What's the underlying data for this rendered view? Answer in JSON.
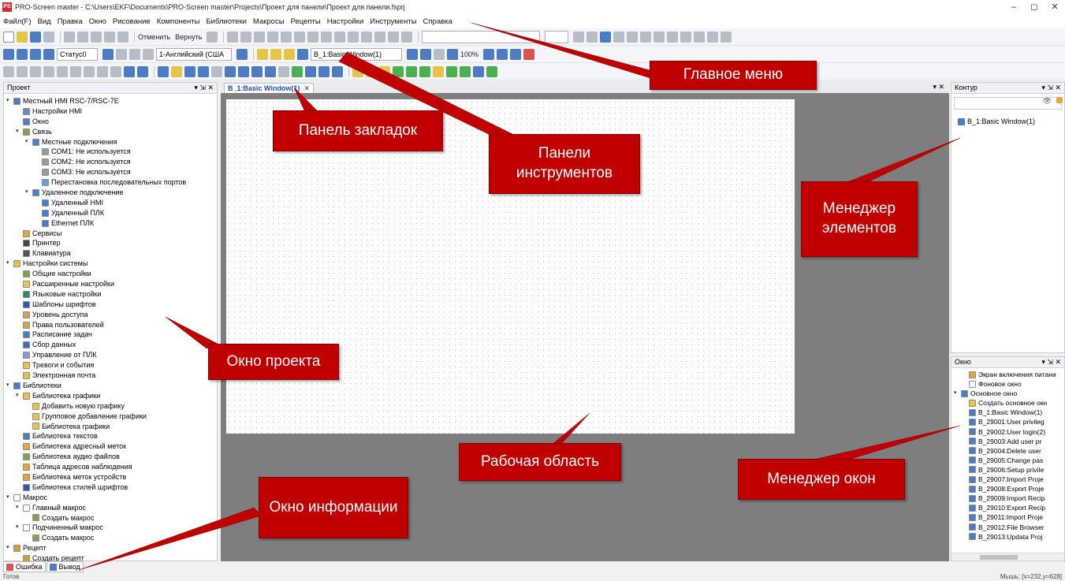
{
  "window": {
    "title": "PRO-Screen master - C:\\Users\\EKF\\Documents\\PRO-Screen master\\Projects\\Проект для панели\\Проект для панели.fsprj",
    "app_icon_text": "PS",
    "controls": [
      "–",
      "◻",
      "✕"
    ]
  },
  "menu": [
    "Файл(F)",
    "Вид",
    "Правка",
    "Окно",
    "Рисование",
    "Компоненты",
    "Библиотеки",
    "Макросы",
    "Рецепты",
    "Настройки",
    "Инструменты",
    "Справка"
  ],
  "toolbar": {
    "undo_label": "Отменить",
    "redo_label": "Вернуть",
    "status_combo": "Статус0",
    "language_combo": "1-Английский (США",
    "window_combo": "B_1:Basic Window(1)",
    "zoom": "100%"
  },
  "project_panel": {
    "title": "Проект",
    "controls": "▾ ⇲ ✕",
    "items": [
      {
        "label": "Местный HMI RSC-7/RSC-7E",
        "level": 0,
        "exp": "▾",
        "color": "#4b7cc4"
      },
      {
        "label": "Настройки HMI",
        "level": 1,
        "exp": "",
        "color": "#6b8cc8"
      },
      {
        "label": "Окно",
        "level": 1,
        "exp": "",
        "color": "#4b7cc4"
      },
      {
        "label": "Связь",
        "level": 1,
        "exp": "▾",
        "color": "#7fa44f"
      },
      {
        "label": "Местные подключения",
        "level": 2,
        "exp": "▾",
        "color": "#4b7cc4"
      },
      {
        "label": "COM1: Не используется",
        "level": 3,
        "exp": "",
        "color": "#9a9a9a"
      },
      {
        "label": "COM2: Не используется",
        "level": 3,
        "exp": "",
        "color": "#9a9a9a"
      },
      {
        "label": "COM3: Не используется",
        "level": 3,
        "exp": "",
        "color": "#9a9a9a"
      },
      {
        "label": "Перестановка последовательных портов",
        "level": 3,
        "exp": "",
        "color": "#6aa0d8"
      },
      {
        "label": "Удаленное подключение",
        "level": 2,
        "exp": "▾",
        "color": "#4b7cc4"
      },
      {
        "label": "Удаленный HMI",
        "level": 3,
        "exp": "",
        "color": "#4b7cc4"
      },
      {
        "label": "Удаленный ПЛК",
        "level": 3,
        "exp": "",
        "color": "#4b7cc4"
      },
      {
        "label": "Ethernet ПЛК",
        "level": 3,
        "exp": "",
        "color": "#4b7cc4"
      },
      {
        "label": "Сервисы",
        "level": 1,
        "exp": "",
        "color": "#e8a33a"
      },
      {
        "label": "Принтер",
        "level": 1,
        "exp": "",
        "color": "#444444"
      },
      {
        "label": "Клавиатура",
        "level": 1,
        "exp": "",
        "color": "#555555"
      },
      {
        "label": "Настройки системы",
        "level": 0,
        "exp": "▾",
        "color": "#e8c34a"
      },
      {
        "label": "Общие настройки",
        "level": 1,
        "exp": "",
        "color": "#7fa44f"
      },
      {
        "label": "Расширенные настройки",
        "level": 1,
        "exp": "",
        "color": "#e8c34a"
      },
      {
        "label": "Языковые настройки",
        "level": 1,
        "exp": "",
        "color": "#2e8b57"
      },
      {
        "label": "Шаблоны шрифтов",
        "level": 1,
        "exp": "",
        "color": "#2d5fa8"
      },
      {
        "label": "Уровень доступа",
        "level": 1,
        "exp": "",
        "color": "#d9a04a"
      },
      {
        "label": "Права пользователей",
        "level": 1,
        "exp": "",
        "color": "#d9a04a"
      },
      {
        "label": "Расписание задач",
        "level": 1,
        "exp": "",
        "color": "#4b7cc4"
      },
      {
        "label": "Сбор данных",
        "level": 1,
        "exp": "",
        "color": "#3a6fc4"
      },
      {
        "label": "Управление от ПЛК",
        "level": 1,
        "exp": "",
        "color": "#7a9fd0"
      },
      {
        "label": "Тревоги и события",
        "level": 1,
        "exp": "",
        "color": "#e8c34a"
      },
      {
        "label": "Электронная почта",
        "level": 1,
        "exp": "",
        "color": "#e8c34a"
      },
      {
        "label": "Библиотеки",
        "level": 0,
        "exp": "▾",
        "color": "#4b7cc4"
      },
      {
        "label": "Библиотека графики",
        "level": 1,
        "exp": "▾",
        "color": "#e8c34a"
      },
      {
        "label": "Добавить новую графику",
        "level": 2,
        "exp": "",
        "color": "#e8c34a"
      },
      {
        "label": "Групповое добавление графики",
        "level": 2,
        "exp": "",
        "color": "#e8c34a"
      },
      {
        "label": "Библиотека графики",
        "level": 2,
        "exp": "",
        "color": "#e8c34a"
      },
      {
        "label": "Библиотека текстов",
        "level": 1,
        "exp": "",
        "color": "#4b7cc4"
      },
      {
        "label": "Библиотека адресный меток",
        "level": 1,
        "exp": "",
        "color": "#e8a33a"
      },
      {
        "label": "Библиотека аудио файлов",
        "level": 1,
        "exp": "",
        "color": "#7fa44f"
      },
      {
        "label": "Таблица адресов наблюдения",
        "level": 1,
        "exp": "",
        "color": "#e8a33a"
      },
      {
        "label": "Библиотека меток устройств",
        "level": 1,
        "exp": "",
        "color": "#e8a33a"
      },
      {
        "label": "Библиотека стилей шрифтов",
        "level": 1,
        "exp": "",
        "color": "#2d5fa8"
      },
      {
        "label": "Макрос",
        "level": 0,
        "exp": "▾",
        "color": "#ffffff"
      },
      {
        "label": "Главный макрос",
        "level": 1,
        "exp": "▾",
        "color": "#ffffff"
      },
      {
        "label": "Создать макрос",
        "level": 2,
        "exp": "",
        "color": "#7fa44f"
      },
      {
        "label": "Подчиненный макрос",
        "level": 1,
        "exp": "▾",
        "color": "#ffffff"
      },
      {
        "label": "Создать макрос",
        "level": 2,
        "exp": "",
        "color": "#7fa44f"
      },
      {
        "label": "Рецепт",
        "level": 0,
        "exp": "▾",
        "color": "#c8a23a"
      },
      {
        "label": "Создать рецепт",
        "level": 1,
        "exp": "",
        "color": "#c8a23a"
      }
    ]
  },
  "bottom_tabs": [
    "Ошибка",
    "Вывод"
  ],
  "document_tab": {
    "label": "B_1:Basic Window(1)",
    "close": "✕"
  },
  "work_tabbar_controls": "▾ ✕",
  "kontur_panel": {
    "title": "Контур",
    "controls": "▾ ⇲ ✕",
    "eye_icon": "👁",
    "item": "B_1:Basic Window(1)"
  },
  "okno_panel": {
    "title": "Окно",
    "controls": "▾ ⇲ ✕",
    "items": [
      {
        "label": "Экран включения питани",
        "level": 1,
        "exp": "",
        "color": "#e8a33a"
      },
      {
        "label": "Фоновое окно",
        "level": 1,
        "exp": "",
        "color": "#ffffff"
      },
      {
        "label": "Основное окно",
        "level": 0,
        "exp": "▾",
        "color": "#4b7cc4"
      },
      {
        "label": "Создать основное окн",
        "level": 1,
        "exp": "",
        "color": "#e8c34a"
      },
      {
        "label": "B_1:Basic Window(1)",
        "level": 1,
        "exp": "",
        "color": "#4b7cc4"
      },
      {
        "label": "B_29001:User privileg",
        "level": 1,
        "exp": "",
        "color": "#4b7cc4"
      },
      {
        "label": "B_29002:User login(2)",
        "level": 1,
        "exp": "",
        "color": "#4b7cc4"
      },
      {
        "label": "B_29003:Add user pr",
        "level": 1,
        "exp": "",
        "color": "#4b7cc4"
      },
      {
        "label": "B_29004:Delete user",
        "level": 1,
        "exp": "",
        "color": "#4b7cc4"
      },
      {
        "label": "B_29005:Change pas",
        "level": 1,
        "exp": "",
        "color": "#4b7cc4"
      },
      {
        "label": "B_29006:Setup privile",
        "level": 1,
        "exp": "",
        "color": "#4b7cc4"
      },
      {
        "label": "B_29007:Import Proje",
        "level": 1,
        "exp": "",
        "color": "#4b7cc4"
      },
      {
        "label": "B_29008:Export Proje",
        "level": 1,
        "exp": "",
        "color": "#4b7cc4"
      },
      {
        "label": "B_29009:Import Recip",
        "level": 1,
        "exp": "",
        "color": "#4b7cc4"
      },
      {
        "label": "B_29010:Export Recip",
        "level": 1,
        "exp": "",
        "color": "#4b7cc4"
      },
      {
        "label": "B_29011:Import Proje",
        "level": 1,
        "exp": "",
        "color": "#4b7cc4"
      },
      {
        "label": "B_29012:File Browser",
        "level": 1,
        "exp": "",
        "color": "#4b7cc4"
      },
      {
        "label": "B_29013:Updata Proj",
        "level": 1,
        "exp": "",
        "color": "#4b7cc4"
      }
    ]
  },
  "status": {
    "left": "Готов",
    "right": "Мышь: [x=232,y=628]"
  },
  "annotations": {
    "main_menu": "Главное меню",
    "tab_bar": "Панель закладок",
    "toolbars": "Панели инструментов",
    "element_manager": "Менеджер элементов",
    "project_window": "Окно проекта",
    "work_area": "Рабочая область",
    "window_manager": "Менеджер окон",
    "info_window": "Окно информации"
  },
  "colors": {
    "callout": "#c00000",
    "work_area": "#7e7e7e",
    "doc_tab_text": "#1a4fb0"
  }
}
